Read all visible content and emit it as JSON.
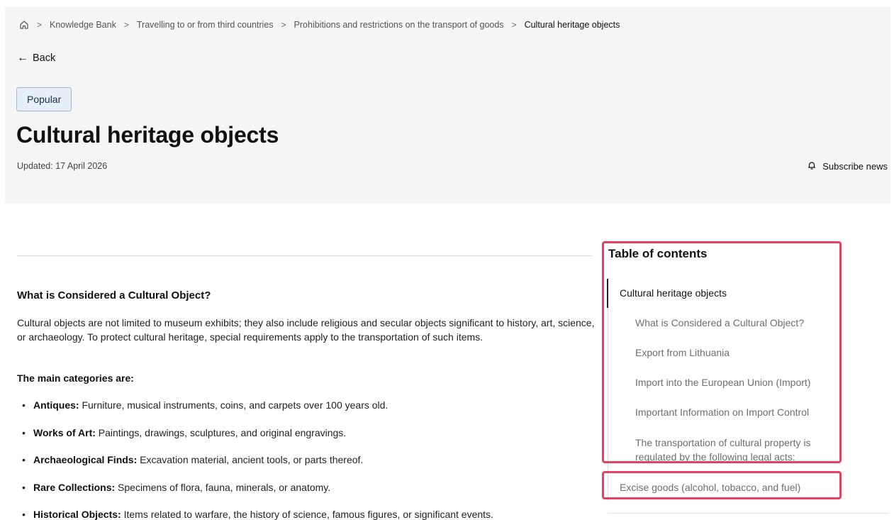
{
  "breadcrumb": {
    "items": [
      "Knowledge Bank",
      "Travelling to or from third countries",
      "Prohibitions and restrictions on the transport of goods"
    ],
    "current": "Cultural heritage objects"
  },
  "back_label": "Back",
  "badge": "Popular",
  "title": "Cultural heritage objects",
  "updated": "Updated: 17 April 2026",
  "subscribe_label": "Subscribe news",
  "content": {
    "heading": "What is Considered a Cultural Object?",
    "intro": "Cultural objects are not limited to museum exhibits; they also include religious and secular objects significant to history, art, science, or archaeology. To protect cultural heritage, special requirements apply to the transportation of such items.",
    "categories_heading": "The main categories are:",
    "categories": [
      {
        "term": "Antiques:",
        "text": " Furniture, musical instruments, coins, and carpets over 100 years old."
      },
      {
        "term": "Works of Art:",
        "text": " Paintings, drawings, sculptures, and original engravings."
      },
      {
        "term": "Archaeological Finds:",
        "text": " Excavation material, ancient tools, or parts thereof."
      },
      {
        "term": "Rare Collections:",
        "text": " Specimens of flora, fauna, minerals, or anatomy."
      },
      {
        "term": "Historical Objects:",
        "text": " Items related to warfare, the history of science, famous figures, or significant events."
      }
    ]
  },
  "toc": {
    "title": "Table of contents",
    "items": [
      "Cultural heritage objects",
      "What is Considered a Cultural Object?",
      "Export from Lithuania",
      "Import into the European Union (Import)",
      "Important Information on Import Control",
      "The transportation of cultural property is regulated by the following legal acts:",
      "Excise goods (alcohol, tobacco, and fuel)"
    ]
  },
  "icons": [
    "home-icon",
    "arrow-left-icon",
    "bell-icon"
  ],
  "colors": {
    "highlight": "#e63f64",
    "badge_bg": "#e6eff8",
    "hero_bg": "#f5f5f5"
  }
}
